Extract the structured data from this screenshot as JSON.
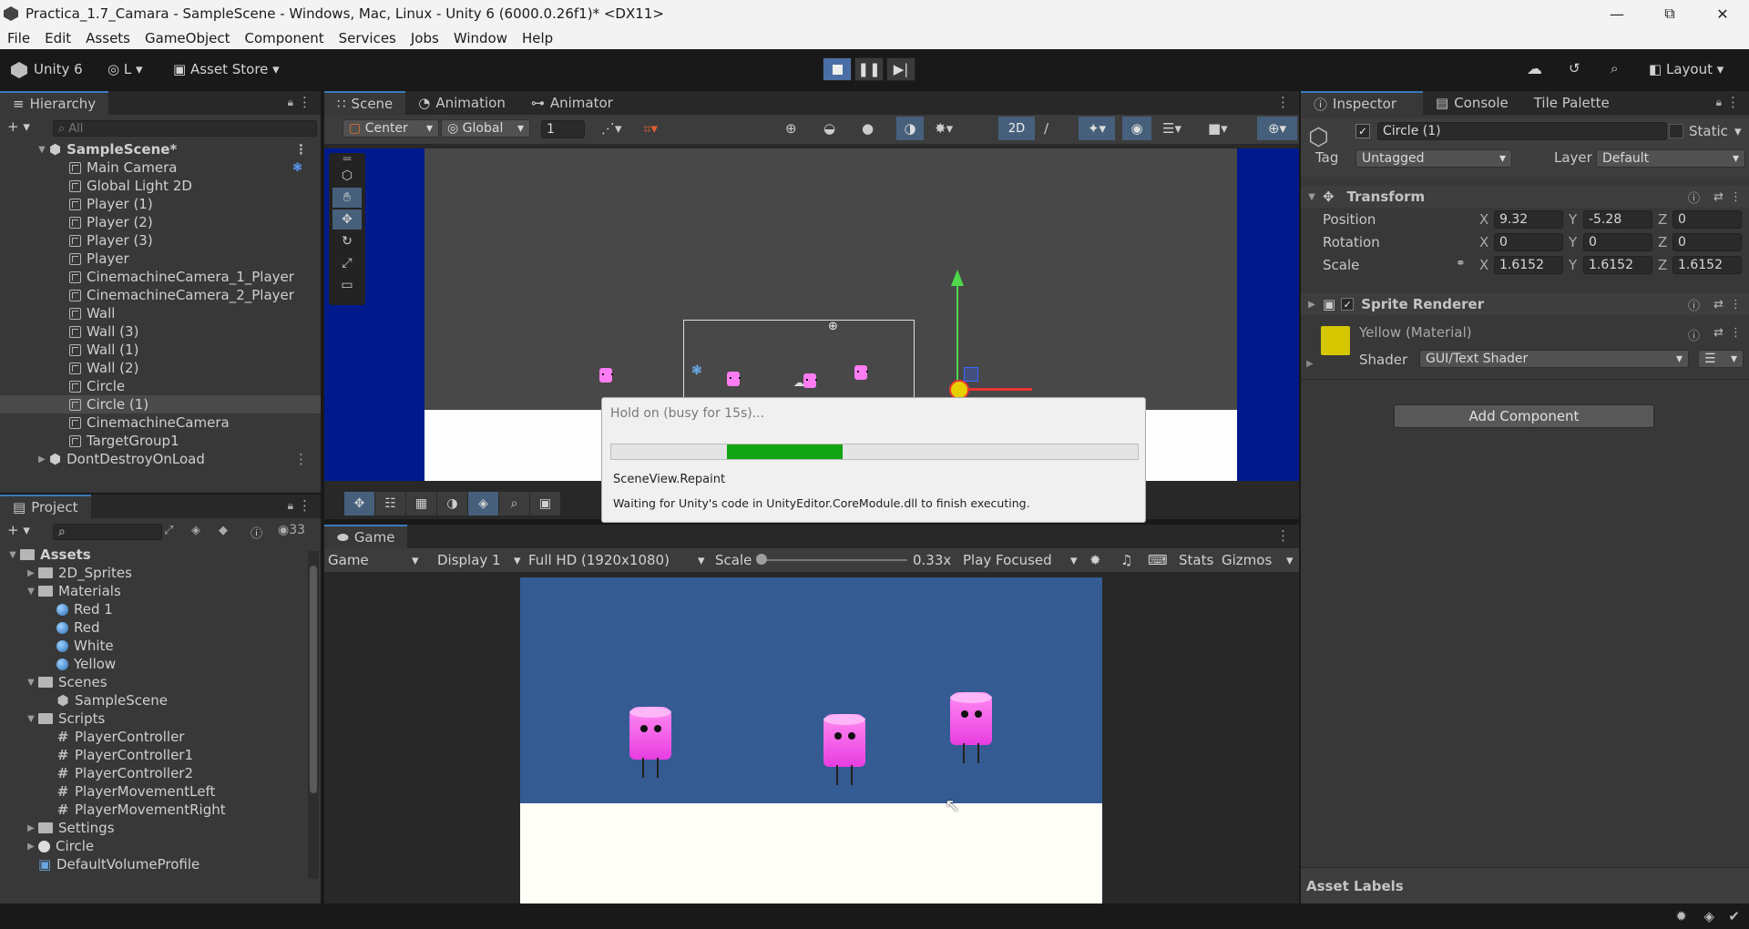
{
  "window": {
    "title": "Practica_1.7_Camara - SampleScene - Windows, Mac, Linux - Unity 6 (6000.0.26f1)* <DX11>"
  },
  "menu": [
    "File",
    "Edit",
    "Assets",
    "GameObject",
    "Component",
    "Services",
    "Jobs",
    "Window",
    "Help"
  ],
  "toolbar": {
    "unity_label": "Unity 6",
    "account": "L",
    "asset_store": "Asset Store",
    "layout": "Layout"
  },
  "hierarchy": {
    "tab": "Hierarchy",
    "search_placeholder": "All",
    "scene": "SampleScene*",
    "items": [
      "Main Camera",
      "Global Light 2D",
      "Player (1)",
      "Player (2)",
      "Player (3)",
      "Player",
      "CinemachineCamera_1_Player",
      "CinemachineCamera_2_Player",
      "Wall",
      "Wall (3)",
      "Wall (1)",
      "Wall (2)",
      "Circle",
      "Circle (1)",
      "CinemachineCamera",
      "TargetGroup1"
    ],
    "selected": "Circle (1)",
    "dont_destroy": "DontDestroyOnLoad"
  },
  "scene_view": {
    "tabs": [
      "Scene",
      "Animation",
      "Animator"
    ],
    "pivot": "Center",
    "space": "Global",
    "grid_value": "1",
    "mode_2d": "2D"
  },
  "busy_dialog": {
    "title": "Hold on (busy for 15s)...",
    "progress": 0.22,
    "task": "SceneView.Repaint",
    "message": "Waiting for Unity's code in UnityEditor.CoreModule.dll to finish executing."
  },
  "project": {
    "tab": "Project",
    "count": "33",
    "tree": [
      {
        "label": "Assets",
        "depth": 0,
        "kind": "folder",
        "open": true
      },
      {
        "label": "2D_Sprites",
        "depth": 1,
        "kind": "folder",
        "open": false
      },
      {
        "label": "Materials",
        "depth": 1,
        "kind": "folder",
        "open": true
      },
      {
        "label": "Red 1",
        "depth": 2,
        "kind": "material"
      },
      {
        "label": "Red",
        "depth": 2,
        "kind": "material"
      },
      {
        "label": "White",
        "depth": 2,
        "kind": "material"
      },
      {
        "label": "Yellow",
        "depth": 2,
        "kind": "material"
      },
      {
        "label": "Scenes",
        "depth": 1,
        "kind": "folder",
        "open": true
      },
      {
        "label": "SampleScene",
        "depth": 2,
        "kind": "scene"
      },
      {
        "label": "Scripts",
        "depth": 1,
        "kind": "folder",
        "open": true
      },
      {
        "label": "PlayerController",
        "depth": 2,
        "kind": "script"
      },
      {
        "label": "PlayerController1",
        "depth": 2,
        "kind": "script"
      },
      {
        "label": "PlayerController2",
        "depth": 2,
        "kind": "script"
      },
      {
        "label": "PlayerMovementLeft",
        "depth": 2,
        "kind": "script"
      },
      {
        "label": "PlayerMovementRight",
        "depth": 2,
        "kind": "script"
      },
      {
        "label": "Settings",
        "depth": 1,
        "kind": "folder",
        "open": false
      },
      {
        "label": "Circle",
        "depth": 1,
        "kind": "sprite",
        "open": false
      },
      {
        "label": "DefaultVolumeProfile",
        "depth": 1,
        "kind": "asset"
      }
    ]
  },
  "game_view": {
    "tab": "Game",
    "mode": "Game",
    "display": "Display 1",
    "resolution": "Full HD (1920x1080)",
    "scale_label": "Scale",
    "scale_value": "0.33x",
    "play_focus": "Play Focused",
    "stats": "Stats",
    "gizmos": "Gizmos"
  },
  "inspector": {
    "tabs": [
      "Inspector",
      "Console",
      "Tile Palette"
    ],
    "object_name": "Circle (1)",
    "static_label": "Static",
    "tag_label": "Tag",
    "tag": "Untagged",
    "layer_label": "Layer",
    "layer": "Default",
    "transform": {
      "title": "Transform",
      "position_label": "Position",
      "position": {
        "x": "9.32",
        "y": "-5.28",
        "z": "0"
      },
      "rotation_label": "Rotation",
      "rotation": {
        "x": "0",
        "y": "0",
        "z": "0"
      },
      "scale_label": "Scale",
      "scale": {
        "x": "1.6152",
        "y": "1.6152",
        "z": "1.6152"
      }
    },
    "sprite_renderer": {
      "title": "Sprite Renderer"
    },
    "material": {
      "name": "Yellow (Material)",
      "shader_label": "Shader",
      "shader": "GUI/Text Shader",
      "swatch": "#d4c600"
    },
    "add_component": "Add Component",
    "asset_labels": "Asset Labels"
  },
  "axis_letters": {
    "x": "X",
    "y": "Y",
    "z": "Z"
  }
}
